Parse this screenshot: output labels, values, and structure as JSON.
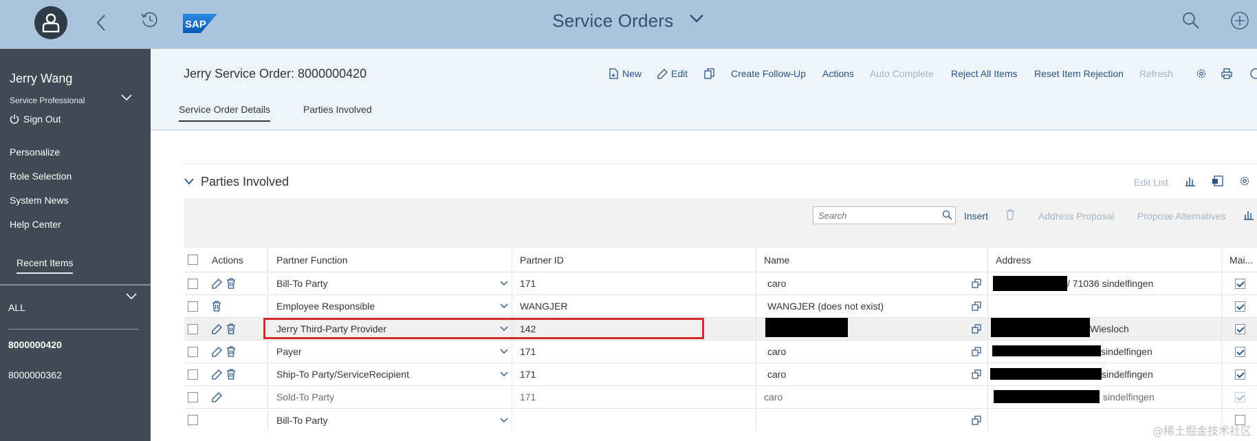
{
  "shell": {
    "title": "Service Orders",
    "logo_text": "SAP"
  },
  "sidebar": {
    "user_name": "Jerry Wang",
    "user_role": "Service Professional",
    "sign_out": "Sign Out",
    "links": [
      "Personalize",
      "Role Selection",
      "System News",
      "Help Center"
    ],
    "recent_label": "Recent Items",
    "filter_label": "ALL",
    "recent_items": [
      "8000000420",
      "8000000362"
    ]
  },
  "header": {
    "title": "Jerry Service Order: 8000000420",
    "toolbar": {
      "new": "New",
      "edit": "Edit",
      "create_follow_up": "Create Follow-Up",
      "actions": "Actions",
      "auto_complete": "Auto Complete",
      "reject_all_items": "Reject All Items",
      "reset_item_rejection": "Reset Item Rejection",
      "refresh": "Refresh"
    },
    "tabs": [
      "Service Order Details",
      "Parties Involved"
    ]
  },
  "section": {
    "title": "Parties Involved",
    "edit_list": "Edit List",
    "search_placeholder": "Search",
    "insert": "Insert",
    "address_proposal": "Address Proposal",
    "propose_alternatives": "Propose Alternatives"
  },
  "table": {
    "columns": [
      "Actions",
      "Partner Function",
      "Partner ID",
      "Name",
      "Address",
      "Mai..."
    ],
    "rows": [
      {
        "function": "Bill-To Party",
        "partner_id": "171",
        "name": "caro",
        "address": "/ 71036 sindelfingen"
      },
      {
        "function": "Employee Responsible",
        "partner_id": "WANGJER",
        "name": "WANGJER (does not exist)",
        "address": ""
      },
      {
        "function": "Jerry Third-Party Provider",
        "partner_id": "142",
        "name": "",
        "address": "Wiesloch"
      },
      {
        "function": "Payer",
        "partner_id": "171",
        "name": "caro",
        "address": "sindelfingen"
      },
      {
        "function": "Ship-To Party/ServiceRecipient",
        "partner_id": "171",
        "name": "caro",
        "address": "sindelfingen"
      },
      {
        "function": "Sold-To Party",
        "partner_id": "171",
        "name": "caro",
        "address": "sindelfingen"
      },
      {
        "function": "Bill-To Party",
        "partner_id": "",
        "name": "",
        "address": ""
      }
    ]
  },
  "watermark": "@稀土掘金技术社区",
  "colors": {
    "shell_bg": "#a9c4dc",
    "sidebar_bg": "#3f4a54",
    "header_bg": "#eff4f9",
    "link": "#2a5484",
    "highlight": "#d52a2a"
  }
}
